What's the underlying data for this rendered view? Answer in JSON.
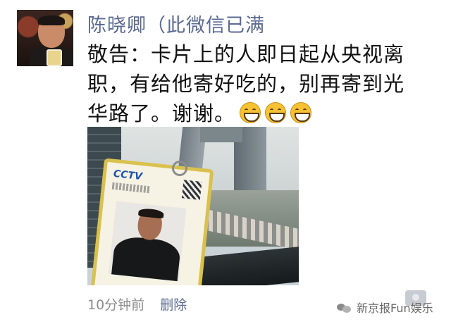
{
  "post": {
    "author_name": "陈晓卿（此微信已满",
    "message_text": "敬告：卡片上的人即日起从央视离职，有给他寄好吃的，别再寄到光华路了。谢谢。",
    "emoji_icons": [
      "grin-emoji-icon",
      "grin-emoji-icon",
      "grin-emoji-icon"
    ],
    "timestamp": "10分钟前",
    "delete_label": "删除"
  },
  "photo": {
    "badge_logo": "CCTV"
  },
  "watermark": {
    "text": "新京报Fun娱乐"
  },
  "colors": {
    "author_name": "#5b6a91",
    "message": "#111111",
    "timestamp": "#8d8d8d",
    "delete": "#5b6a91"
  }
}
